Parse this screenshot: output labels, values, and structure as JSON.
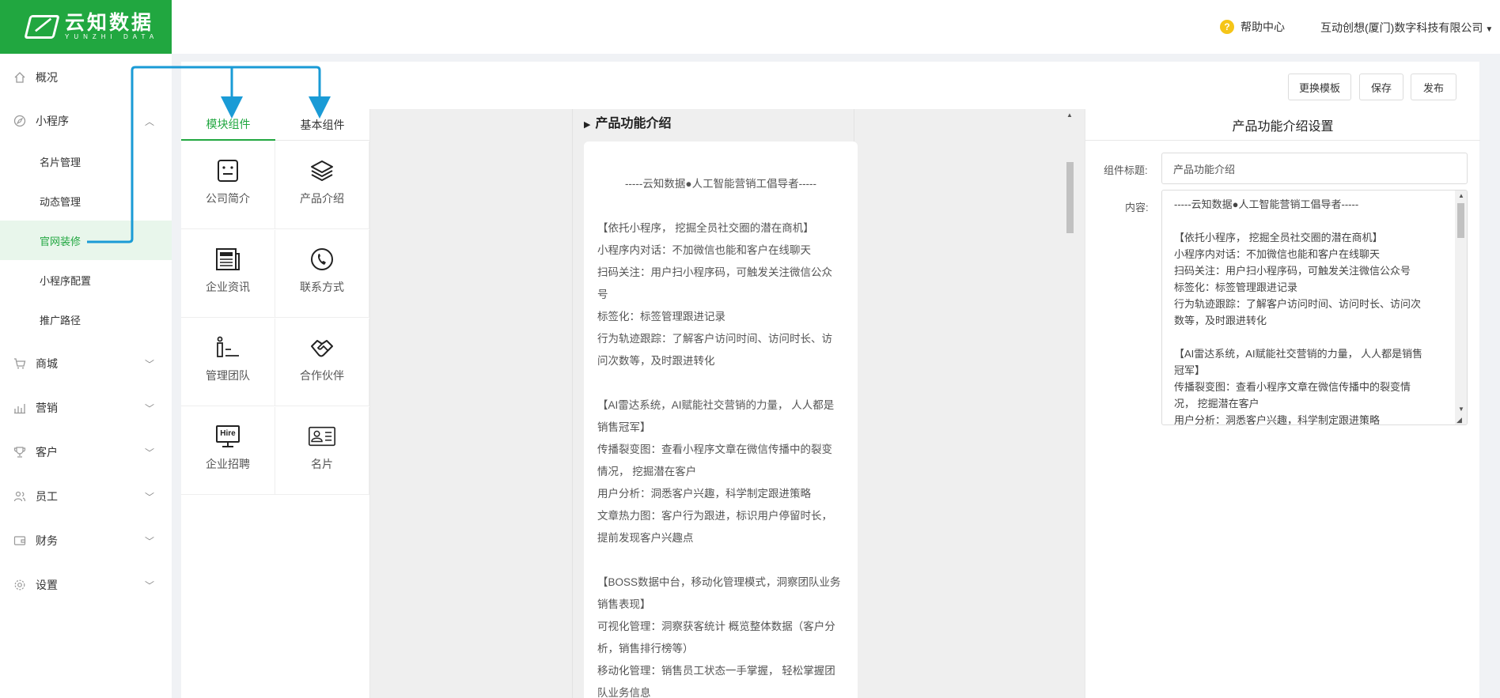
{
  "header": {
    "brand_cn": "云知数据",
    "brand_en": "YUNZHI DATA",
    "help_label": "帮助中心",
    "company_name": "互动创想(厦门)数字科技有限公司",
    "accent_color": "#21a740"
  },
  "sidebar": {
    "items": [
      {
        "label": "概况",
        "icon": "home-icon"
      },
      {
        "label": "小程序",
        "icon": "compass-icon"
      },
      {
        "label": "商城",
        "icon": "cart-icon"
      },
      {
        "label": "营销",
        "icon": "chart-icon"
      },
      {
        "label": "客户",
        "icon": "trophy-icon"
      },
      {
        "label": "员工",
        "icon": "users-icon"
      },
      {
        "label": "财务",
        "icon": "wallet-icon"
      },
      {
        "label": "设置",
        "icon": "gear-icon"
      }
    ],
    "sub_items": [
      {
        "label": "名片管理"
      },
      {
        "label": "动态管理"
      },
      {
        "label": "官网装修",
        "active": true
      },
      {
        "label": "小程序配置"
      },
      {
        "label": "推广路径"
      }
    ]
  },
  "toolbar": {
    "change_template": "更换模板",
    "save": "保存",
    "publish": "发布"
  },
  "palette": {
    "tabs": [
      {
        "label": "模块组件",
        "active": true
      },
      {
        "label": "基本组件"
      }
    ],
    "components": [
      {
        "label": "公司简介",
        "icon": "company-icon"
      },
      {
        "label": "产品介绍",
        "icon": "layers-icon"
      },
      {
        "label": "企业资讯",
        "icon": "newspaper-icon"
      },
      {
        "label": "联系方式",
        "icon": "phone-icon"
      },
      {
        "label": "管理团队",
        "icon": "team-icon"
      },
      {
        "label": "合作伙伴",
        "icon": "handshake-icon"
      },
      {
        "label": "企业招聘",
        "icon": "hire-icon"
      },
      {
        "label": "名片",
        "icon": "card-icon"
      }
    ],
    "hire_badge": "Hire"
  },
  "preview": {
    "section_title": "产品功能介绍",
    "lines": [
      "-----云知数据●人工智能营销工倡导者-----",
      "",
      "【依托小程序， 挖掘全员社交圈的潜在商机】",
      "小程序内对话：不加微信也能和客户在线聊天",
      "扫码关注：用户扫小程序码，可触发关注微信公众",
      "号",
      "标签化：标签管理跟进记录",
      "行为轨迹跟踪：了解客户访问时间、访问时长、访",
      "问次数等，及时跟进转化",
      "",
      "【AI雷达系统，AI赋能社交营销的力量， 人人都是",
      "销售冠军】",
      "传播裂变图：查看小程序文章在微信传播中的裂变",
      "情况， 挖掘潜在客户",
      "用户分析：洞悉客户兴趣，科学制定跟进策略",
      "文章热力图：客户行为跟进，标识用户停留时长，",
      "提前发现客户兴趣点",
      "",
      "【BOSS数据中台，移动化管理模式，洞察团队业务",
      "销售表现】",
      "可视化管理：洞察获客统计 概览整体数据（客户分",
      "析，销售排行榜等）",
      "移动化管理：销售员工状态一手掌握， 轻松掌握团",
      "队业务信息"
    ]
  },
  "settings": {
    "title": "产品功能介绍设置",
    "title_label": "组件标题:",
    "title_value": "产品功能介绍",
    "content_label": "内容:",
    "content_lines": [
      "-----云知数据●人工智能营销工倡导者-----",
      "",
      "【依托小程序， 挖掘全员社交圈的潜在商机】",
      "小程序内对话：不加微信也能和客户在线聊天",
      "扫码关注：用户扫小程序码，可触发关注微信公众号",
      "标签化：标签管理跟进记录",
      "行为轨迹跟踪：了解客户访问时间、访问时长、访问次",
      "数等，及时跟进转化",
      "",
      "【AI雷达系统，AI赋能社交营销的力量， 人人都是销售",
      "冠军】",
      "传播裂变图：查看小程序文章在微信传播中的裂变情",
      "况， 挖掘潜在客户",
      "用户分析：洞悉客户兴趣，科学制定跟进策略"
    ]
  },
  "annotation_color": "#1a9bd6"
}
